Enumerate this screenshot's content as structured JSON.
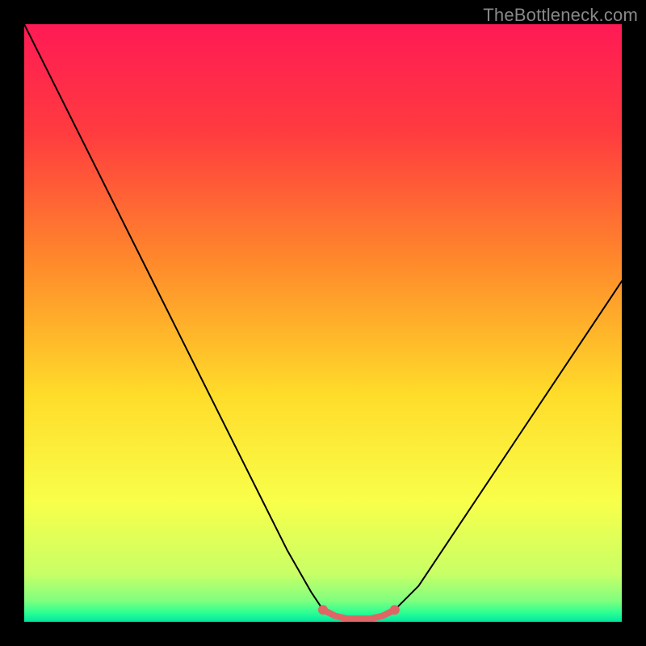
{
  "watermark": "TheBottleneck.com",
  "chart_data": {
    "type": "line",
    "title": "",
    "xlabel": "",
    "ylabel": "",
    "xlim": [
      0,
      100
    ],
    "ylim": [
      0,
      100
    ],
    "background_gradient_stops": [
      {
        "offset": 0,
        "color": "#ff1a55"
      },
      {
        "offset": 0.18,
        "color": "#ff3b3f"
      },
      {
        "offset": 0.4,
        "color": "#ff8a2b"
      },
      {
        "offset": 0.62,
        "color": "#ffdc2a"
      },
      {
        "offset": 0.8,
        "color": "#f8ff4a"
      },
      {
        "offset": 0.92,
        "color": "#c8ff66"
      },
      {
        "offset": 0.965,
        "color": "#7fff7f"
      },
      {
        "offset": 0.985,
        "color": "#2bff93"
      },
      {
        "offset": 1.0,
        "color": "#00e5a0"
      }
    ],
    "series": [
      {
        "name": "curve",
        "stroke": "#000000",
        "stroke_width": 2,
        "x": [
          0,
          4,
          8,
          12,
          16,
          20,
          24,
          28,
          32,
          36,
          40,
          44,
          48,
          50,
          52,
          54,
          56,
          58,
          60,
          62,
          66,
          70,
          74,
          78,
          82,
          86,
          90,
          94,
          98,
          100
        ],
        "values": [
          100,
          92,
          84,
          76,
          68,
          60,
          52,
          44,
          36,
          28,
          20,
          12,
          5,
          2,
          1,
          0.5,
          0.5,
          0.5,
          1,
          2,
          6,
          12,
          18,
          24,
          30,
          36,
          42,
          48,
          54,
          57
        ]
      },
      {
        "name": "flat-highlight",
        "stroke": "#e06666",
        "stroke_width": 8,
        "x": [
          50,
          52,
          54,
          56,
          58,
          60,
          62
        ],
        "values": [
          2,
          1,
          0.5,
          0.5,
          0.5,
          1,
          2
        ]
      }
    ],
    "markers": [
      {
        "name": "left-dot",
        "x": 50,
        "y": 2,
        "color": "#e06666",
        "r": 6
      },
      {
        "name": "right-dot",
        "x": 62,
        "y": 2,
        "color": "#e06666",
        "r": 6
      }
    ]
  }
}
